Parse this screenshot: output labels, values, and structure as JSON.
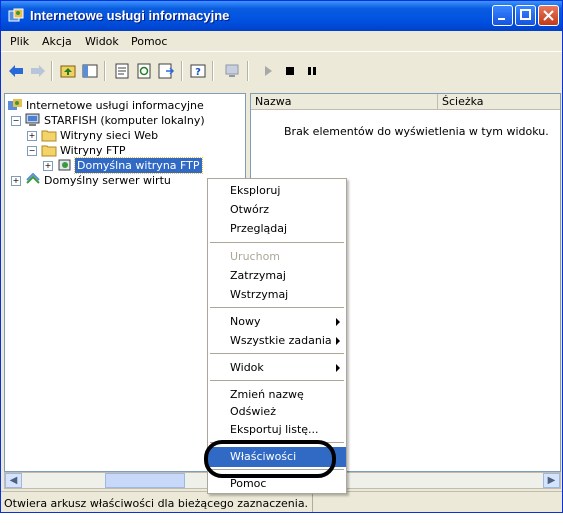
{
  "window": {
    "title": "Internetowe usługi informacyjne"
  },
  "menubar": {
    "items": [
      "Plik",
      "Akcja",
      "Widok",
      "Pomoc"
    ]
  },
  "tree": {
    "root": "Internetowe usługi informacyjne",
    "computer": "STARFISH (komputer lokalny)",
    "websites": "Witryny sieci Web",
    "ftp_sites": "Witryny FTP",
    "default_ftp": "Domyślna witryna FTP",
    "virtual_server": "Domyślny serwer wirtu"
  },
  "list": {
    "columns": [
      "Nazwa",
      "Ścieżka"
    ],
    "empty_message": "Brak elementów do wyświetlenia w tym widoku."
  },
  "context_menu": {
    "items": [
      "Eksploruj",
      "Otwórz",
      "Przeglądaj",
      "Uruchom",
      "Zatrzymaj",
      "Wstrzymaj",
      "Nowy",
      "Wszystkie zadania",
      "Widok",
      "Zmień nazwę",
      "Odśwież",
      "Eksportuj listę...",
      "Właściwości",
      "Pomoc"
    ],
    "disabled": [
      "Uruchom"
    ],
    "highlighted": "Właściwości"
  },
  "statusbar": {
    "text": "Otwiera arkusz właściwości dla bieżącego zaznaczenia."
  },
  "colors": {
    "titlebar": "#0050E0",
    "selection": "#316AC5",
    "window_bg": "#ECE9D8"
  }
}
